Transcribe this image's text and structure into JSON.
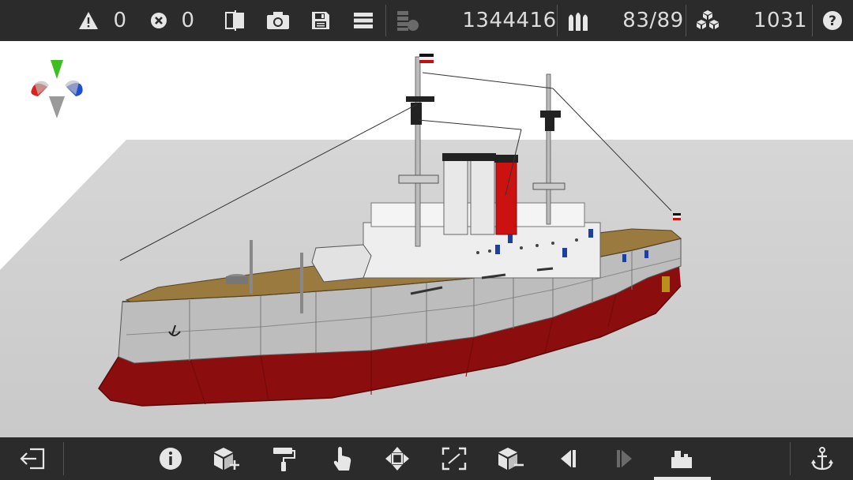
{
  "toolbar": {
    "warnings_count": "0",
    "errors_count": "0",
    "polygon_count": "1344416",
    "ammo_count": "83/89",
    "parts_count": "1031"
  },
  "toolbar_icons": [
    "warning-icon",
    "error-icon",
    "split-view-icon",
    "camera-icon",
    "save-icon",
    "menu-icon",
    "polygons-icon",
    "ammo-icon",
    "parts-icon",
    "help-icon"
  ],
  "bottom_icons": [
    "exit-icon",
    "info-icon",
    "add-part-icon",
    "paint-roller-icon",
    "hand-icon",
    "move-icon",
    "scale-icon",
    "remove-part-icon",
    "previous-icon",
    "next-icon",
    "ship-mode-icon",
    "anchor-icon"
  ],
  "colors": {
    "bar_bg": "#2b2b2b",
    "icon": "#e6e6e6",
    "hull_red": "#8b0d0d",
    "hull_grey": "#b9b9b9",
    "deck_wood": "#9a7a3e",
    "funnel_red": "#cc1111"
  }
}
